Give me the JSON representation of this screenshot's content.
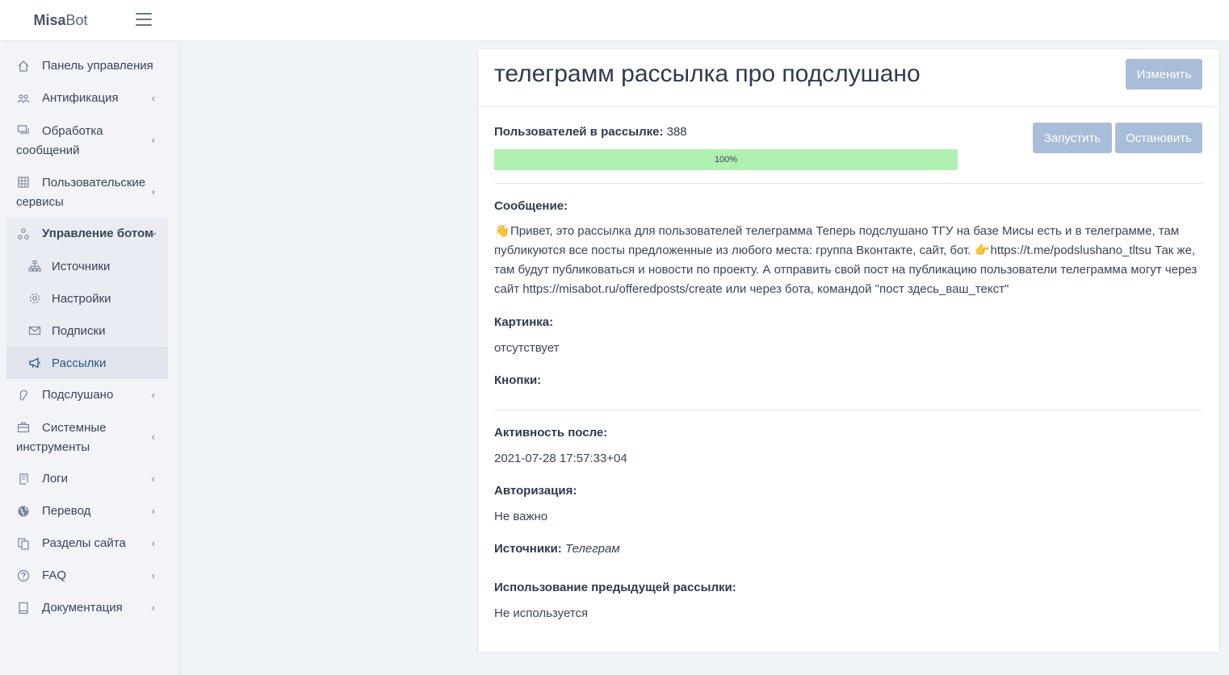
{
  "header": {
    "brand_bold": "Misa",
    "brand_light": "Bot"
  },
  "sidebar": {
    "items": [
      {
        "label": "Панель управления",
        "icon": "home-icon"
      },
      {
        "label": "Антификация",
        "icon": "users-icon"
      },
      {
        "label": "Обработка сообщений",
        "icon": "chat-icon"
      },
      {
        "label": "Пользовательские сервисы",
        "icon": "grid-icon"
      },
      {
        "label": "Управление ботом",
        "icon": "nodes-icon"
      },
      {
        "label": "Подслушано",
        "icon": "ear-icon"
      },
      {
        "label": "Системные инструменты",
        "icon": "briefcase-icon"
      },
      {
        "label": "Логи",
        "icon": "scroll-icon"
      },
      {
        "label": "Перевод",
        "icon": "globe-icon"
      },
      {
        "label": "Разделы сайта",
        "icon": "copy-icon"
      },
      {
        "label": "FAQ",
        "icon": "question-icon"
      },
      {
        "label": "Документация",
        "icon": "book-icon"
      }
    ],
    "sub_items": [
      {
        "label": "Источники",
        "icon": "sitemap-icon"
      },
      {
        "label": "Настройки",
        "icon": "gear-icon"
      },
      {
        "label": "Подписки",
        "icon": "envelope-icon"
      },
      {
        "label": "Рассылки",
        "icon": "megaphone-icon"
      }
    ]
  },
  "card": {
    "title": "телеграмм рассылка про подслушано",
    "edit_button": "Изменить",
    "start_button": "Запустить",
    "stop_button": "Остановить",
    "users_label": "Пользователей в рассылке:",
    "users_count": "388",
    "progress_text": "100%",
    "progress_value": 100,
    "message_label": "Сообщение:",
    "message_emoji1": "👋",
    "message_part1": "Привет, это рассылка для пользователей телеграмма Теперь подслушано ТГУ на базе Мисы есть и в телеграмме, там публикуются все посты предложенные из любого места: группа Вконтакте, сайт, бот. ",
    "message_emoji2": "👉",
    "message_part2": "https://t.me/podslushano_tltsu Так же, там будут публиковаться и новости по проекту. А отправить свой пост на публикацию пользователи телеграмма могут через сайт https://misabot.ru/offeredposts/create или через бота, командой \"пост здесь_ваш_текст\"",
    "image_label": "Картинка:",
    "image_value": "отсутствует",
    "buttons_label": "Кнопки:",
    "activity_label": "Активность после:",
    "activity_value": "2021-07-28 17:57:33+04",
    "auth_label": "Авторизация:",
    "auth_value": "Не важно",
    "sources_label": "Источники:",
    "sources_value": "Телеграм",
    "prev_label": "Использование предыдущей рассылки:",
    "prev_value": "Не используется"
  },
  "colors": {
    "button_bg": "#a8bdd8",
    "progress_fill": "#aef1b1",
    "active_link": "#2a5488"
  }
}
